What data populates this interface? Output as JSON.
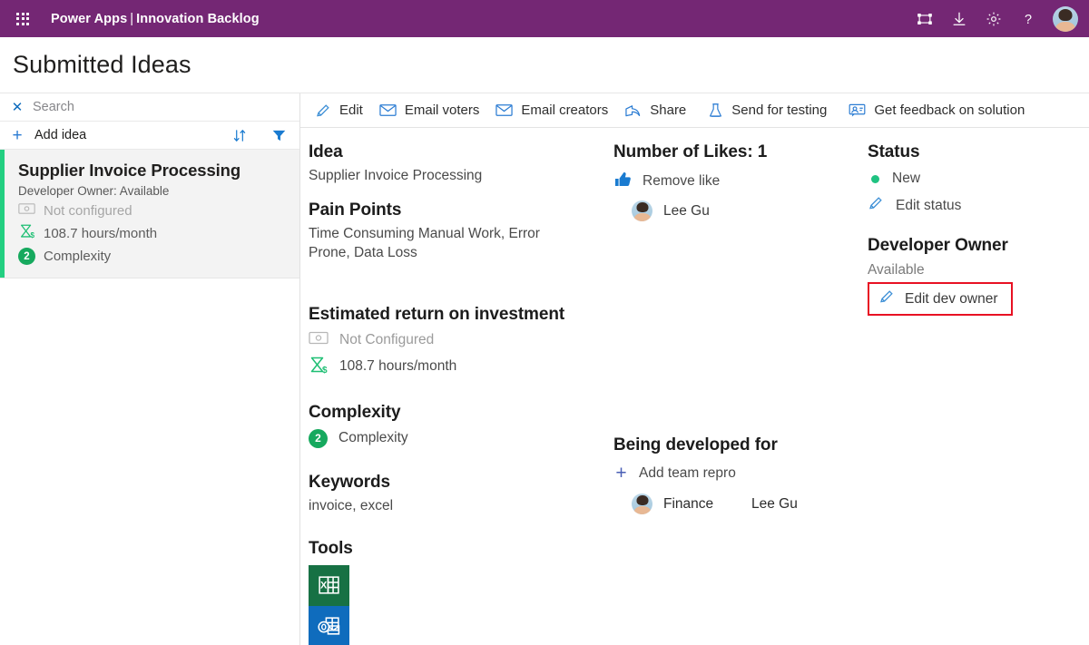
{
  "appbar": {
    "waffle_icon": "waffle-grid-icon",
    "product": "Power Apps",
    "separator": "|",
    "app_name": "Innovation Backlog",
    "actions": [
      {
        "name": "fit-to-screen-icon",
        "label": "Fit to screen"
      },
      {
        "name": "download-icon",
        "label": "Download"
      },
      {
        "name": "gear-icon",
        "label": "Settings"
      },
      {
        "name": "help-icon",
        "label": "Help"
      }
    ],
    "avatar_label": "User account"
  },
  "page": {
    "title": "Submitted Ideas"
  },
  "sidebar": {
    "search": {
      "clear_icon": "close-icon",
      "placeholder": "Search",
      "value": ""
    },
    "add_idea": {
      "icon": "plus-icon",
      "label": "Add idea"
    },
    "sort_icon": "sort-icon",
    "filter_icon": "filter-icon",
    "cards": [
      {
        "title": "Supplier Invoice Processing",
        "subtitle": "Developer Owner: Available",
        "roi_icon": "money-icon",
        "roi_text": "Not configured",
        "hours_icon": "hourglass-dollar-icon",
        "hours_text": "108.7 hours/month",
        "complexity_value": "2",
        "complexity_text": "Complexity",
        "accent_color": "#23cf81",
        "selected": true
      }
    ]
  },
  "commandbar": {
    "items": [
      {
        "icon": "pencil-icon",
        "label": "Edit"
      },
      {
        "icon": "mail-icon",
        "label": "Email voters"
      },
      {
        "icon": "mail-icon",
        "label": "Email creators"
      },
      {
        "icon": "share-icon",
        "label": "Share"
      },
      {
        "icon": "flask-icon",
        "label": "Send for testing"
      },
      {
        "icon": "feedback-icon",
        "label": "Get feedback on solution"
      }
    ]
  },
  "detail": {
    "idea": {
      "heading": "Idea",
      "value": "Supplier Invoice Processing"
    },
    "pain_points": {
      "heading": "Pain Points",
      "value": "Time Consuming Manual Work, Error Prone, Data Loss"
    },
    "roi": {
      "heading": "Estimated return on investment",
      "money_icon": "money-icon",
      "money_text": "Not Configured",
      "hours_icon": "hourglass-dollar-icon",
      "hours_text": "108.7 hours/month"
    },
    "complexity": {
      "heading": "Complexity",
      "value": "2",
      "label": "Complexity"
    },
    "keywords": {
      "heading": "Keywords",
      "value": "invoice, excel"
    },
    "tools": {
      "heading": "Tools",
      "items": [
        {
          "name": "excel-icon",
          "label": "Excel",
          "color": "#177144"
        },
        {
          "name": "outlook-icon",
          "label": "Outlook",
          "color": "#0f6cbd"
        }
      ]
    },
    "likes": {
      "heading": "Number of Likes: 1",
      "count": 1,
      "action_icon": "thumbs-up-icon",
      "action_label": "Remove like",
      "voters": [
        {
          "name": "Lee Gu"
        }
      ]
    },
    "developed_for": {
      "heading": "Being developed for",
      "add_icon": "plus-icon",
      "add_label": "Add team repro",
      "teams": [
        {
          "team": "Finance",
          "owner": "Lee Gu"
        }
      ]
    },
    "status": {
      "heading": "Status",
      "value": "New",
      "dot_color": "#1fc281",
      "edit_icon": "pencil-icon",
      "edit_label": "Edit status"
    },
    "developer_owner": {
      "heading": "Developer Owner",
      "value": "Available",
      "edit_icon": "pencil-icon",
      "edit_label": "Edit dev owner",
      "highlight_color": "#e81123"
    }
  }
}
